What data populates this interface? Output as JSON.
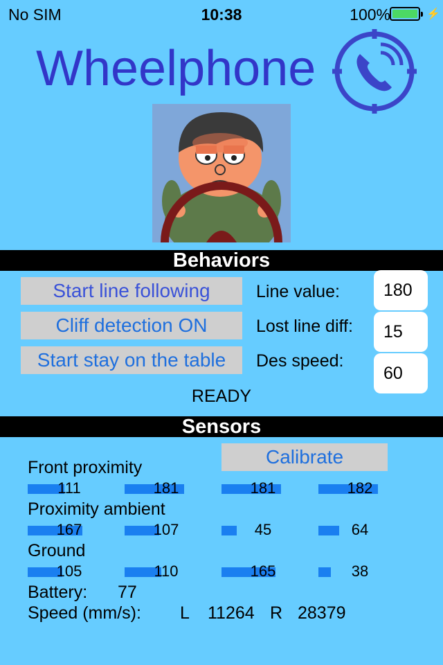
{
  "status_bar": {
    "carrier": "No SIM",
    "time": "10:38",
    "battery": "100%"
  },
  "app": {
    "title": "Wheelphone"
  },
  "behaviors": {
    "header": "Behaviors",
    "buttons": {
      "line_following": "Start line following",
      "cliff": "Cliff detection ON",
      "stay_table": "Start stay on the table"
    },
    "fields": {
      "line_value": {
        "label": "Line value:",
        "value": "180"
      },
      "lost_line_diff": {
        "label": "Lost line diff:",
        "value": "15"
      },
      "des_speed": {
        "label": "Des speed:",
        "value": "60"
      }
    },
    "state": "READY"
  },
  "sensors": {
    "header": "Sensors",
    "calibrate": "Calibrate",
    "front_proximity": {
      "label": "Front proximity",
      "values": [
        "111",
        "181",
        "181",
        "182"
      ],
      "levels": [
        0.44,
        0.72,
        0.72,
        0.72
      ]
    },
    "proximity_ambient": {
      "label": "Proximity ambient",
      "values": [
        "167",
        "107",
        "45",
        "64"
      ],
      "levels": [
        0.66,
        0.42,
        0.18,
        0.25
      ]
    },
    "ground": {
      "label": "Ground",
      "values": [
        "105",
        "110",
        "165",
        "38"
      ],
      "levels": [
        0.42,
        0.44,
        0.65,
        0.15
      ]
    },
    "battery": {
      "label": "Battery:",
      "value": "77"
    },
    "speed": {
      "label": "Speed (mm/s):",
      "l_label": "L",
      "l_value": "11264",
      "r_label": "R",
      "r_value": "28379"
    }
  },
  "colors": {
    "background": "#66ccff",
    "title": "#3236c8",
    "button_text": "#1e6fde",
    "bar": "#1a7ff0"
  }
}
